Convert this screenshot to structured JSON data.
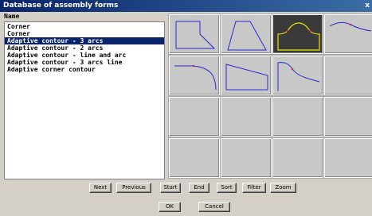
{
  "window": {
    "title": "Database of assembly forms",
    "close_glyph": "x"
  },
  "list": {
    "header": "Name",
    "items": [
      "Corner",
      "Corner",
      "Adaptive contour - 3 arcs",
      "Adaptive contour - 2 arcs",
      "Adaptive contour - line and arc",
      "Adaptive contour - 3 arcs line",
      "Adaptive corner contour"
    ],
    "selected_index": 2
  },
  "buttons": {
    "next": "Next",
    "previous": "Previous",
    "start": "Start",
    "end": "End",
    "sort": "Sort",
    "filter": "Filter",
    "zoom": "Zoom",
    "ok": "OK",
    "cancel": "Cancel"
  },
  "thumbnails": [
    {
      "shape": "corner-cut-polygon",
      "selected": false
    },
    {
      "shape": "trapezoid-slant",
      "selected": false
    },
    {
      "shape": "three-arc-contour",
      "selected": true
    },
    {
      "shape": "arc-ramp",
      "selected": false
    },
    {
      "shape": "line-arc-contour",
      "selected": false
    },
    {
      "shape": "slanted-top-polygon",
      "selected": false
    },
    {
      "shape": "arc-line-contour",
      "selected": false
    },
    {
      "shape": "empty",
      "selected": false
    },
    {
      "shape": "empty",
      "selected": false
    },
    {
      "shape": "empty",
      "selected": false
    },
    {
      "shape": "empty",
      "selected": false
    },
    {
      "shape": "empty",
      "selected": false
    },
    {
      "shape": "empty",
      "selected": false
    },
    {
      "shape": "empty",
      "selected": false
    },
    {
      "shape": "empty",
      "selected": false
    },
    {
      "shape": "empty",
      "selected": false
    }
  ],
  "colors": {
    "title_bar": "#0a246a",
    "selection": "#0a246a",
    "outline": "#2a2acc",
    "active_outline": "#e6e600",
    "arc_mark": "#d02060"
  }
}
